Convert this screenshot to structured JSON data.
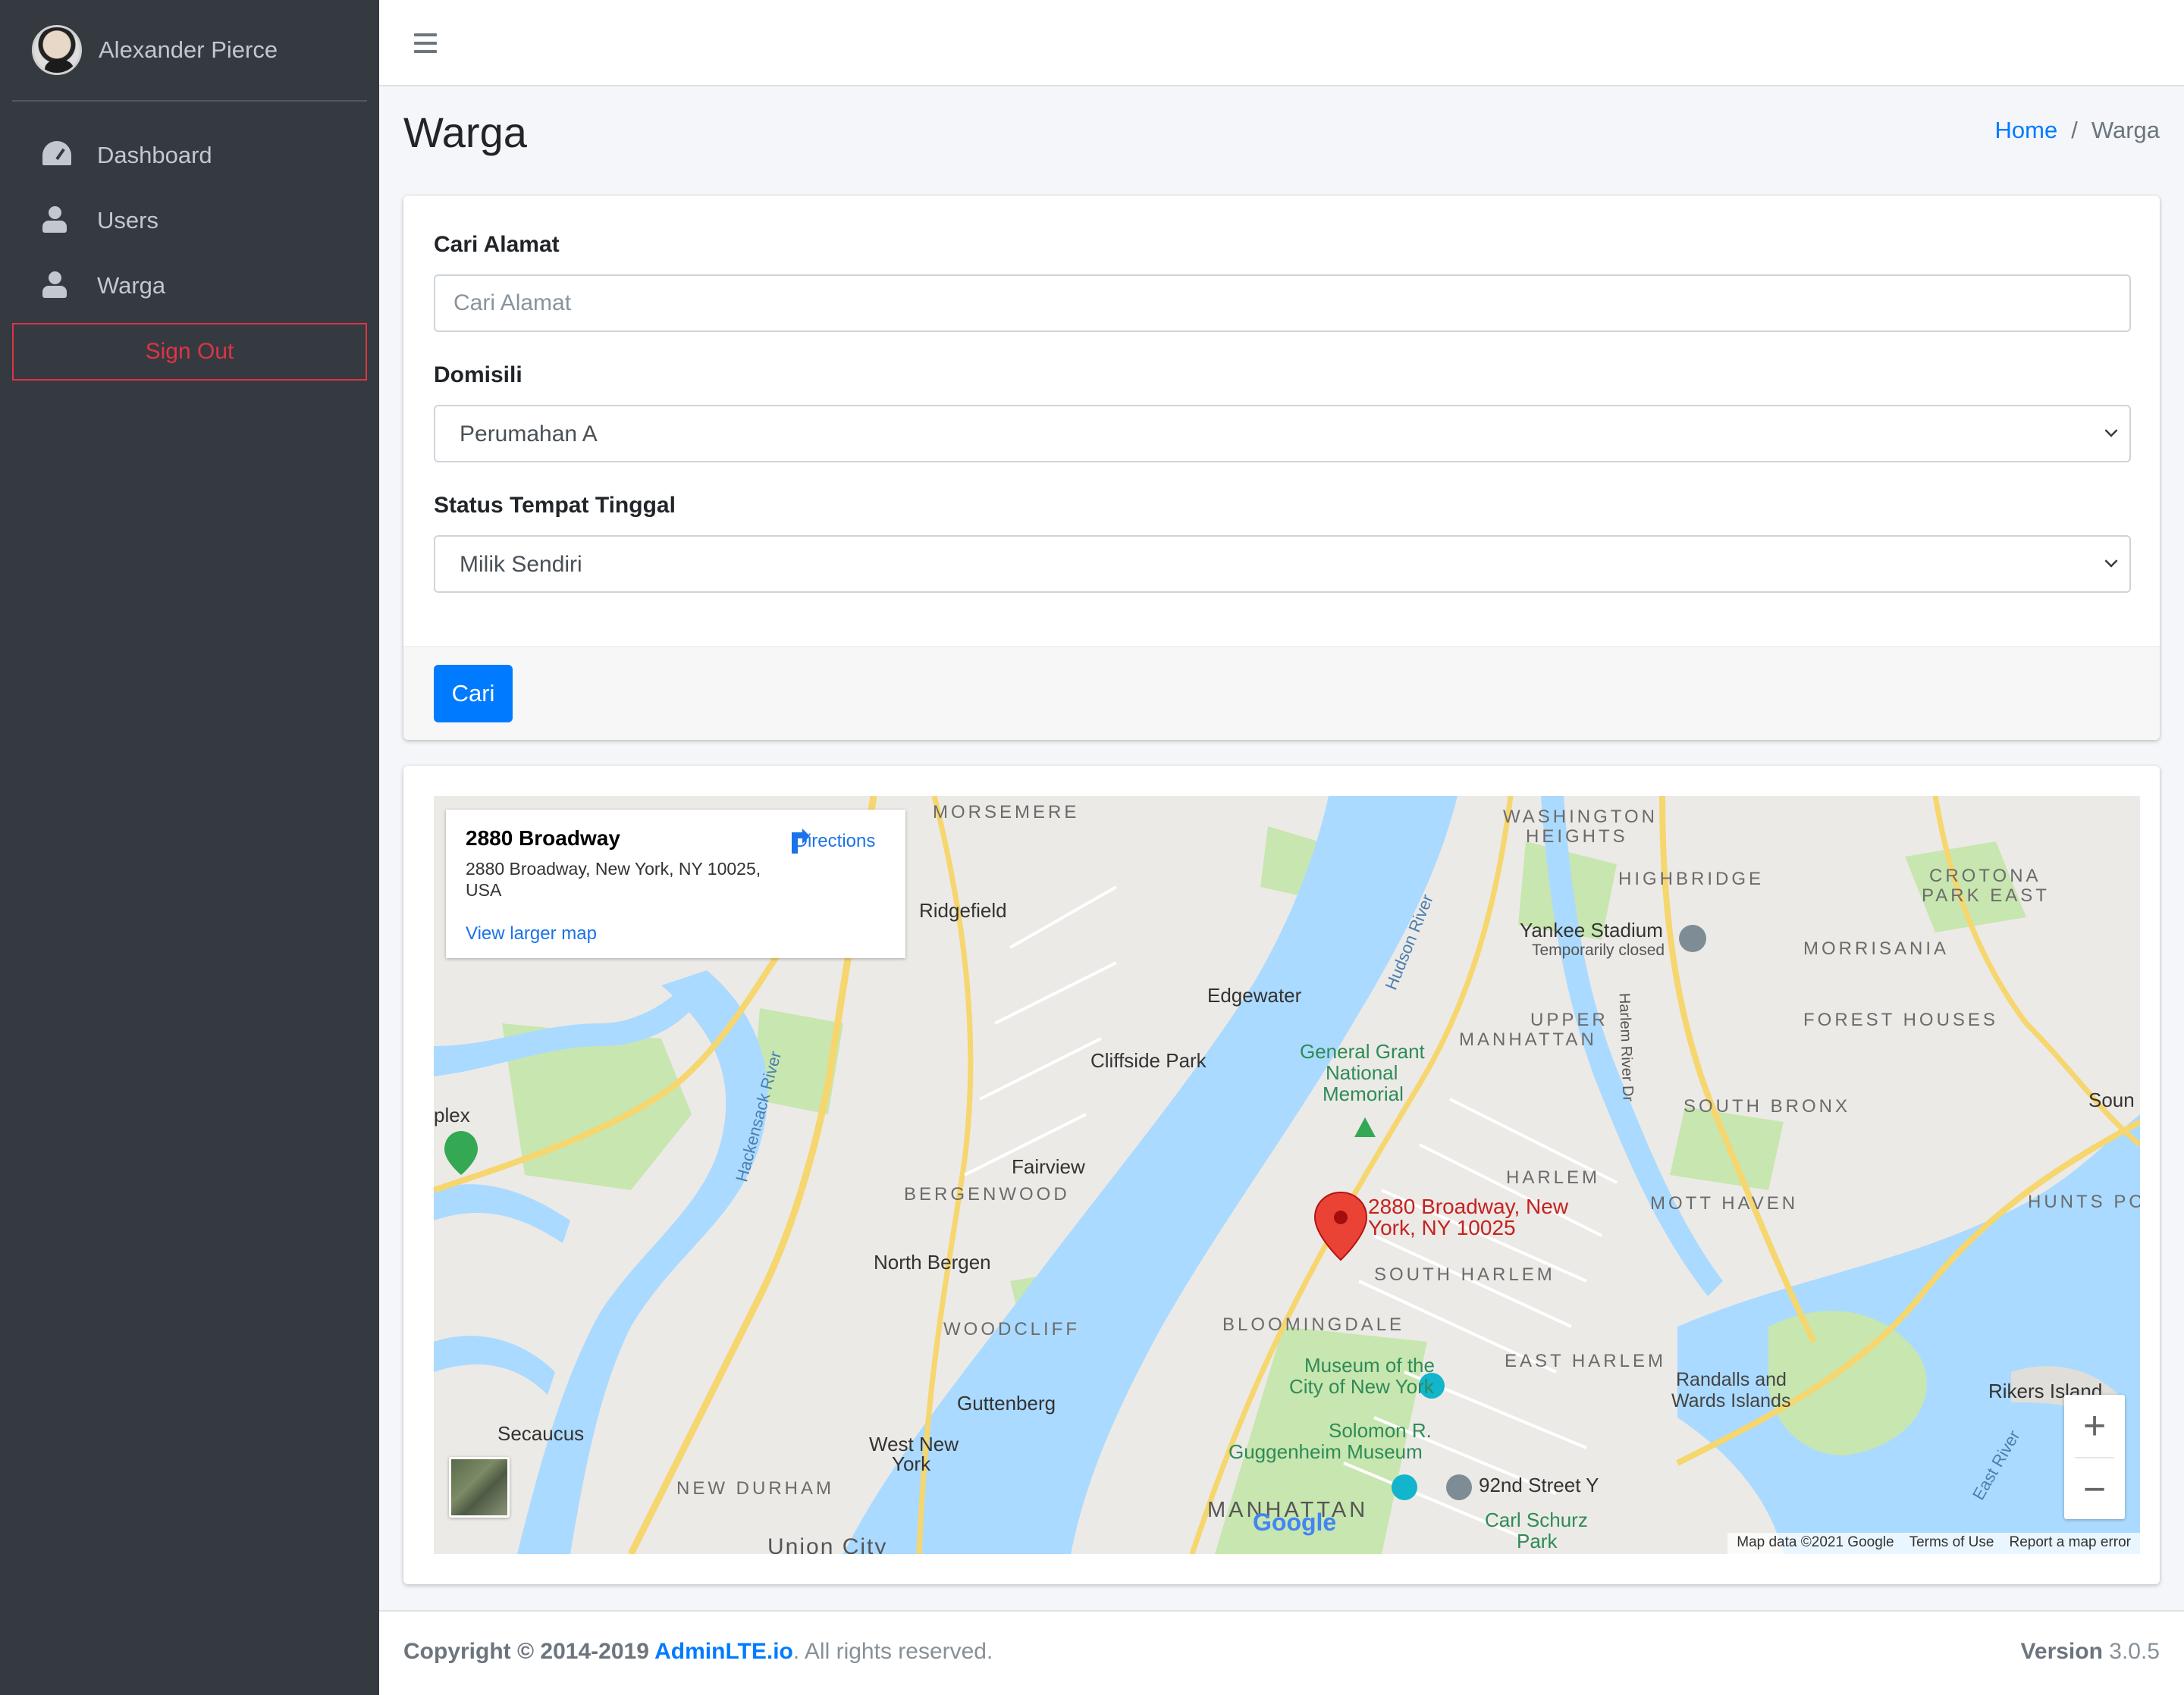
{
  "user": {
    "name": "Alexander Pierce"
  },
  "sidebar": {
    "items": [
      {
        "label": "Dashboard",
        "icon": "tachometer-icon"
      },
      {
        "label": "Users",
        "icon": "user-icon"
      },
      {
        "label": "Warga",
        "icon": "user-icon"
      }
    ],
    "signout_label": "Sign Out"
  },
  "page": {
    "title": "Warga",
    "breadcrumb": {
      "home": "Home",
      "separator": "/",
      "current": "Warga"
    }
  },
  "form": {
    "search_label": "Cari Alamat",
    "search_placeholder": "Cari Alamat",
    "search_value": "",
    "domisili_label": "Domisili",
    "domisili_value": "Perumahan A",
    "status_label": "Status Tempat Tinggal",
    "status_value": "Milik Sendiri",
    "submit_label": "Cari"
  },
  "map": {
    "info": {
      "title": "2880 Broadway",
      "address": "2880 Broadway, New York, NY 10025, USA",
      "directions_label": "Directions",
      "larger_map_label": "View larger map"
    },
    "marker_label_line1": "2880 Broadway, New",
    "marker_label_line2": "York, NY 10025",
    "labels": {
      "morsemere": "MORSEMERE",
      "washington_heights_1": "WASHINGTON",
      "washington_heights_2": "HEIGHTS",
      "highbridge": "HIGHBRIDGE",
      "crotona_1": "CROTONA",
      "crotona_2": "PARK EAST",
      "ridgefield": "Ridgefield",
      "yankee": "Yankee Stadium",
      "yankee_sub": "Temporarily closed",
      "morrisania": "MORRISANIA",
      "edgewater": "Edgewater",
      "upper_manhattan_1": "UPPER",
      "upper_manhattan_2": "MANHATTAN",
      "forest_houses": "FOREST HOUSES",
      "cliffside": "Cliffside Park",
      "grant_1": "General Grant",
      "grant_2": "National",
      "grant_3": "Memorial",
      "south_bronx": "SOUTH BRONX",
      "plex": "plex",
      "fairview": "Fairview",
      "harlem": "HARLEM",
      "bergenwood": "BERGENWOOD",
      "mott_haven": "MOTT HAVEN",
      "hunts_point": "HUNTS POI",
      "north_bergen": "North Bergen",
      "south_harlem": "SOUTH HARLEM",
      "bloomingdale": "BLOOMINGDALE",
      "woodcliff": "WOODCLIFF",
      "east_harlem": "EAST HARLEM",
      "museum_1": "Museum of the",
      "museum_2": "City of New York",
      "randalls_1": "Randalls and",
      "randalls_2": "Wards Islands",
      "guttenberg": "Guttenberg",
      "rikers": "Rikers Island",
      "secaucus": "Secaucus",
      "guggenheim_1": "Solomon R.",
      "guggenheim_2": "Guggenheim Museum",
      "west_new_york_1": "West New",
      "west_new_york_2": "York",
      "street_y": "92nd Street Y",
      "new_durham": "NEW DURHAM",
      "manhattan": "MANHATTAN",
      "carl_schurz_1": "Carl Schurz",
      "carl_schurz_2": "Park",
      "union_city": "Union City",
      "hudson_river": "Hudson River",
      "harlem_river": "Harlem River Dr",
      "east_river": "East River",
      "hackensack": "Hackensack River",
      "soun": "Soun"
    },
    "attribution": {
      "data": "Map data ©2021 Google",
      "terms": "Terms of Use",
      "report": "Report a map error"
    },
    "google_logo": "Google",
    "zoom_in": "+",
    "zoom_out": "−"
  },
  "footer": {
    "copyright_prefix": "Copyright © 2014-2019 ",
    "copyright_link": "AdminLTE.io",
    "copyright_suffix": ". All rights reserved.",
    "version_label": "Version",
    "version_value": "3.0.5"
  },
  "colors": {
    "sidebar_bg": "#343a40",
    "primary": "#007bff",
    "danger": "#dc3545",
    "water": "#aadaff",
    "park": "#c8e6b0"
  }
}
